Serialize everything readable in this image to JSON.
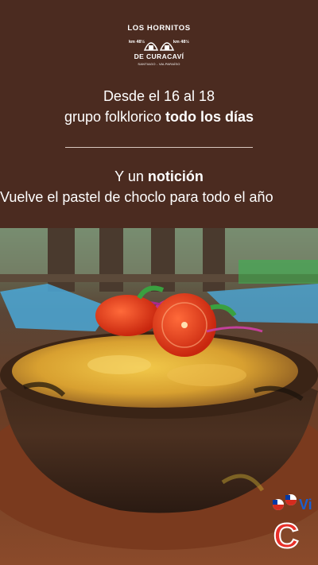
{
  "logo": {
    "line1": "LOS HORNITOS",
    "line2": "DE CURACAVÍ",
    "line3": "SANTIAGO - VALPARAÍSO",
    "km_left": "km 48½",
    "km_right": "km 48½"
  },
  "header": {
    "line1": "Desde el 16 al 18",
    "line2_prefix": "grupo folklorico ",
    "line2_bold": "todo los días",
    "line3_prefix": "Y un ",
    "line3_bold": "notición",
    "line4": "Vuelve el pastel de choclo para todo el año"
  },
  "colors": {
    "background": "#4b2b20",
    "text": "#ffffff",
    "divider": "#d8c8bf"
  },
  "photo": {
    "subject": "pastel de choclo in clay bowl with tomato garnish"
  },
  "badge": {
    "icons": [
      "chile-flag-icon",
      "chile-flag-icon"
    ],
    "text": "Vi"
  }
}
